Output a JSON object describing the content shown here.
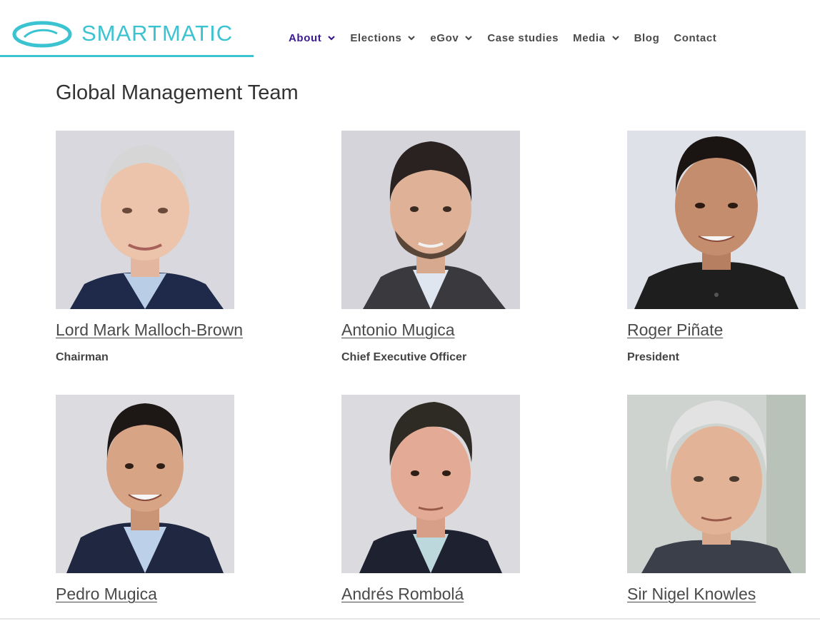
{
  "brand": {
    "name": "SMARTMATIC",
    "accent_color": "#3cc3d2",
    "nav_active_color": "#3b1b8f"
  },
  "nav": {
    "items": [
      {
        "label": "About",
        "has_dropdown": true,
        "active": true
      },
      {
        "label": "Elections",
        "has_dropdown": true,
        "active": false
      },
      {
        "label": "eGov",
        "has_dropdown": true,
        "active": false
      },
      {
        "label": "Case studies",
        "has_dropdown": false,
        "active": false
      },
      {
        "label": "Media",
        "has_dropdown": true,
        "active": false
      },
      {
        "label": "Blog",
        "has_dropdown": false,
        "active": false
      },
      {
        "label": "Contact",
        "has_dropdown": false,
        "active": false
      }
    ]
  },
  "main": {
    "title": "Global Management Team",
    "team": [
      {
        "name": "Lord Mark Malloch-Brown",
        "role": "Chairman"
      },
      {
        "name": "Antonio Mugica",
        "role": "Chief Executive Officer"
      },
      {
        "name": "Roger Piñate",
        "role": "President"
      },
      {
        "name": "Pedro Mugica",
        "role": ""
      },
      {
        "name": "Andrés Rombolá",
        "role": ""
      },
      {
        "name": "Sir Nigel Knowles",
        "role": ""
      }
    ]
  }
}
